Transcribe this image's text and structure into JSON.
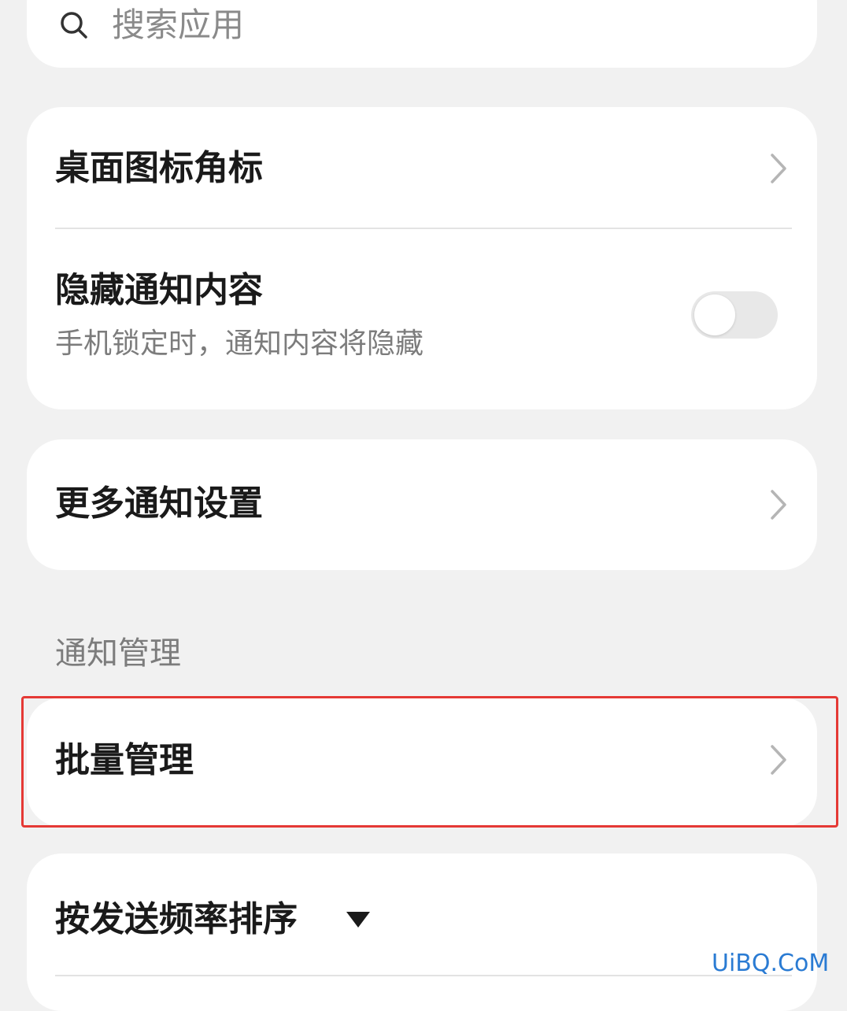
{
  "search": {
    "placeholder": "搜索应用",
    "icon": "search-icon"
  },
  "settings_group_1": {
    "desktop_badge": {
      "label": "桌面图标角标",
      "icon": "chevron-right-icon"
    },
    "hide_content": {
      "label": "隐藏通知内容",
      "description": "手机锁定时，通知内容将隐藏",
      "toggle_state": "off"
    }
  },
  "settings_group_2": {
    "more_settings": {
      "label": "更多通知设置",
      "icon": "chevron-right-icon"
    }
  },
  "notification_management": {
    "section_title": "通知管理",
    "batch_manage": {
      "label": "批量管理",
      "icon": "chevron-right-icon"
    }
  },
  "sort": {
    "label": "按发送频率排序",
    "icon": "dropdown-triangle-icon"
  },
  "watermark": "UiBQ.CoM",
  "colors": {
    "background": "#f1f1f1",
    "card": "#ffffff",
    "highlight": "#e53935",
    "watermark": "#2a7bd3"
  }
}
